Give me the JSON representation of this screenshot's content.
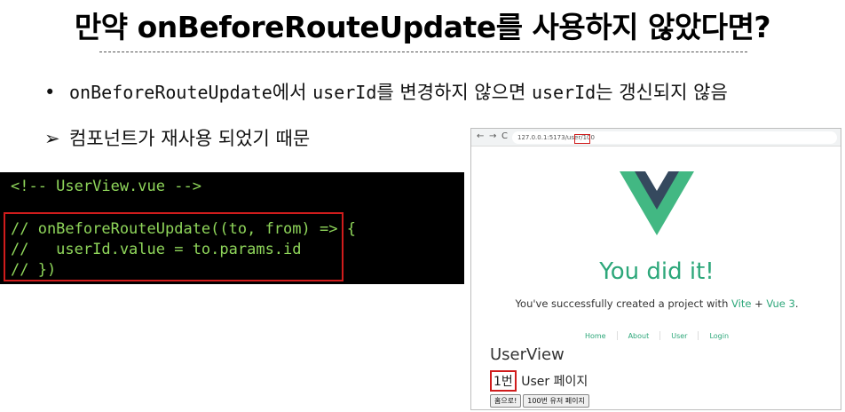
{
  "slide": {
    "title": "만약 onBeforeRouteUpdate를 사용하지 않았다면?",
    "bullet": {
      "marker": "•",
      "part1": "onBeforeRouteUpdate",
      "part2": "에서 ",
      "part3": "userId",
      "part4": "를 변경하지 않으면 ",
      "part5": "userId",
      "part6": "는 갱신되지 않음"
    },
    "sub_bullet": {
      "marker": "➢",
      "text": "컴포넌트가 재사용 되었기 때문"
    }
  },
  "code": {
    "line1": "<!-- UserView.vue -->",
    "line2": "// onBeforeRouteUpdate((to, from) => {",
    "line3": "//   userId.value = to.params.id",
    "line4": "// })"
  },
  "browser": {
    "back": "←",
    "forward": "→",
    "reload": "C",
    "url": "127.0.0.1:5173/user/",
    "url_param": "100",
    "heading": "You did it!",
    "created_prefix": "You've successfully created a project with ",
    "vite": "Vite",
    "plus": " + ",
    "vue3": "Vue 3",
    "period": ".",
    "nav": [
      "Home",
      "About",
      "User",
      "Login"
    ],
    "userview_title": "UserView",
    "user_id": "1번",
    "user_page": " User 페이지",
    "btn_home": "홈으로!",
    "btn_user100": "100번 유저 페이지"
  },
  "colors": {
    "highlight": "#d01c1c",
    "vue_green": "#42b883",
    "vue_dark": "#35495e",
    "code_text": "#8fd65a",
    "link_green": "#2da77a"
  }
}
